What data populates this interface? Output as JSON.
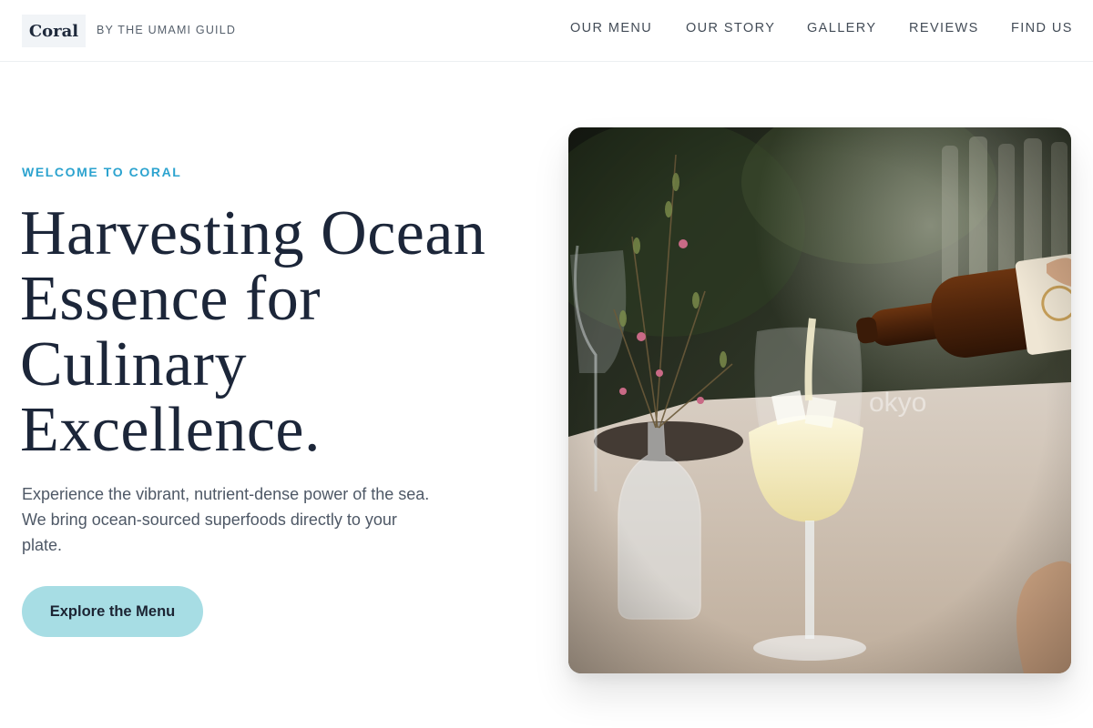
{
  "header": {
    "logo": "Coral",
    "tagline": "BY THE UMAMI GUILD",
    "nav": [
      {
        "label": "OUR MENU"
      },
      {
        "label": "OUR STORY"
      },
      {
        "label": "GALLERY"
      },
      {
        "label": "REVIEWS"
      },
      {
        "label": "FIND US"
      }
    ]
  },
  "hero": {
    "eyebrow": "WELCOME TO CORAL",
    "headline": "Harvesting Ocean Essence for Culinary Excellence.",
    "subtext": "Experience the vibrant, nutrient-dense power of the sea. We bring ocean-sourced superfoods directly to your plate.",
    "cta_label": "Explore the Menu",
    "image_watermark": "okyo"
  },
  "colors": {
    "accent": "#2ca3cf",
    "button_bg": "#a7dde4",
    "headline": "#1c2639",
    "body_text": "#4e5866"
  }
}
